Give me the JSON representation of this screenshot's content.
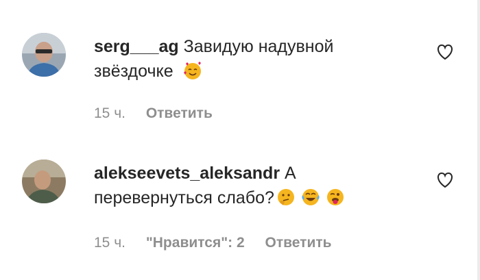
{
  "comments": [
    {
      "username": "serg___ag",
      "text_line1": "Завидую надувной",
      "text_line2": "звёздочке",
      "emojis": [
        "smiling-face-with-hearts"
      ],
      "time": "15 ч.",
      "likes_label": "",
      "reply_label": "Ответить"
    },
    {
      "username": "alekseevets_aleksandr",
      "text_line1": "А",
      "text_line2": "перевернуться слабо?",
      "emojis": [
        "thinking-face",
        "face-with-tears-of-joy",
        "winking-face-with-tongue"
      ],
      "time": "15 ч.",
      "likes_label": "\"Нравится\": 2",
      "reply_label": "Ответить"
    }
  ],
  "colors": {
    "text": "#262626",
    "secondary": "#8e8e8e",
    "emoji_yellow": "#f5b51f"
  },
  "icons": {
    "like": "heart-outline-icon"
  }
}
